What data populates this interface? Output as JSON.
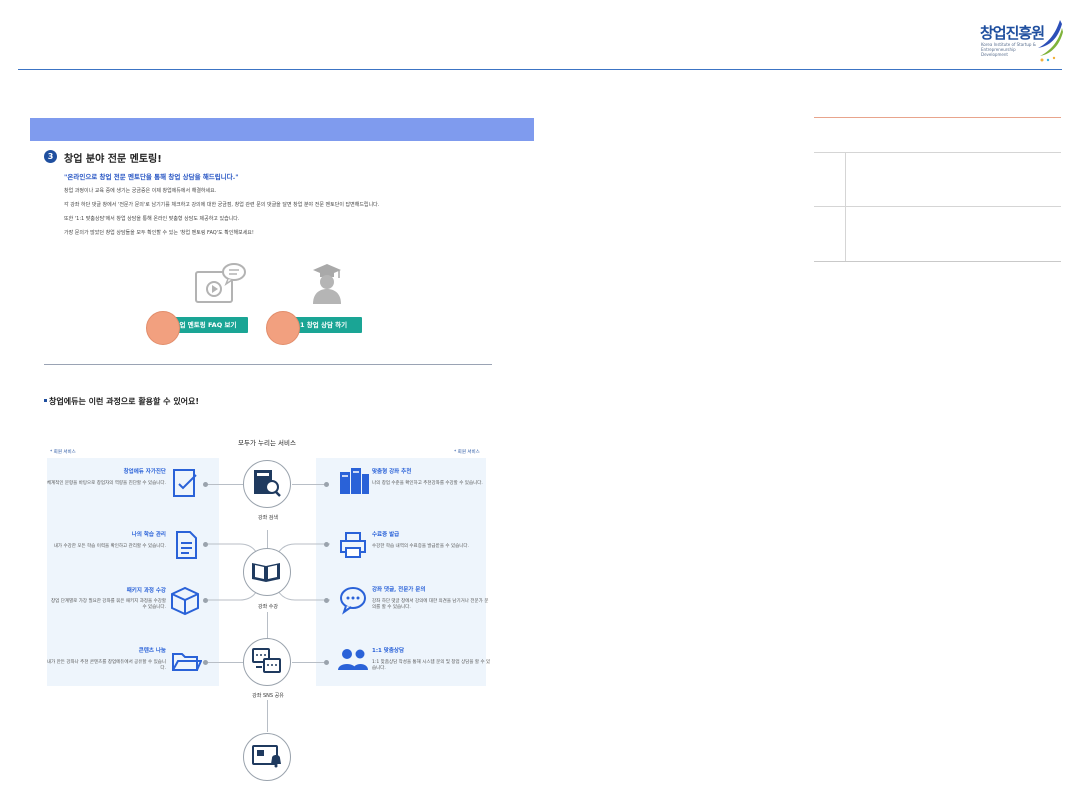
{
  "logo": {
    "name": "창업진흥원",
    "subtitle": "Korea Institute of Startup & Entrepreneurship Development"
  },
  "mentoring": {
    "step_number": "3",
    "title": "창업 분야 전문 멘토링!",
    "quote": "\"온라인으로 창업 전문 멘토단을 통해 창업 상담을 해드립니다.\"",
    "lines": [
      "창업 과정이나 교육 중에 생기는 궁금증은 이제 창업에듀에서 해결하세요.",
      "각 강좌 하단 댓글 창에서 '전문가 문의'로 남기기를 체크하고 강의에 대한 궁금점, 창업 관련 문의 댓글을 달면 창업 분야 전문 멘토단이 답변해드립니다.",
      "또한 '1:1 맞춤상담'에서 창업 상담을 통해 온라인 맞춤형 상담도 제공하고 있습니다.",
      "가장 문의가 많았던 창업 상담들을 모두 확인할 수 있는 '창업 멘토링 FAQ'도 확인해보세요!"
    ],
    "faq_button": "창업 멘토링 FAQ 보기",
    "consult_button": "1:1 창업 상담 하기"
  },
  "section": {
    "title": "창업에듀는 이런 과정으로 활용할 수 있어요!"
  },
  "diagram": {
    "title": "모두가 누리는 서비스",
    "member_left": "* 회원 서비스",
    "member_right": "* 회원 서비스",
    "hubs": [
      {
        "label": "강좌 검색",
        "icon": "book-search-icon"
      },
      {
        "label": "강좌 수강",
        "icon": "open-book-icon"
      },
      {
        "label": "강좌 SNS 공유",
        "icon": "share-chat-icon"
      },
      {
        "label": "",
        "icon": "notification-screen-icon"
      }
    ],
    "left_services": [
      {
        "title": "창업에듀 자가진단",
        "desc": "체계적인 문항을 바탕으로 창업자의 역량을 진단할 수 있습니다.",
        "icon": "diagnosis-icon"
      },
      {
        "title": "나의 학습 관리",
        "desc": "내가 수강한 모든 학습 이력을 확인하고 관리할 수 있습니다.",
        "icon": "document-icon"
      },
      {
        "title": "패키지 과정 수강",
        "desc": "창업 단계별로 가장 필요한 강좌를 묶은 패키지 과정을 수강할 수 있습니다.",
        "icon": "package-box-icon"
      },
      {
        "title": "콘텐츠 나눔",
        "desc": "내가 만든 강좌나 추천 콘텐츠를 창업에듀에서 공유할 수 있습니다.",
        "icon": "folder-icon"
      }
    ],
    "right_services": [
      {
        "title": "맞춤형 강좌 추천",
        "desc": "나의 창업 수준을 확인하고 추천강좌를 수강할 수 있습니다.",
        "icon": "books-stack-icon"
      },
      {
        "title": "수료증 발급",
        "desc": "수강한 학습 내역의 수료증을 발급받을 수 있습니다.",
        "icon": "printer-icon"
      },
      {
        "title": "강좌 댓글, 전문가 문의",
        "desc": "강좌 하단 댓글 창에서 강의에 대한 의견을 남기거나 전문가 문의를 할 수 있습니다.",
        "icon": "speech-bubble-icon"
      },
      {
        "title": "1:1 맞춤상담",
        "desc": "1:1 맞춤상담 작성을 통해 시스템 문의 및 창업 상담을 할 수 있습니다.",
        "icon": "users-icon"
      }
    ]
  },
  "colors": {
    "accent_blue": "#1f4f9f",
    "bar_blue": "#7f9bee",
    "button_green": "#1aa595",
    "highlight_orange": "#f2a07f",
    "service_title_blue": "#2a62d8",
    "panel_bg": "#eef5fc"
  }
}
